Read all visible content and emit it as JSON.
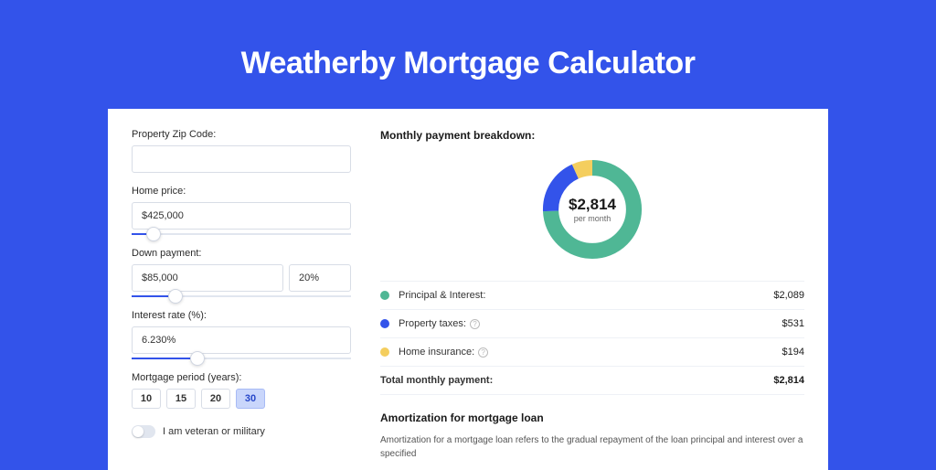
{
  "title": "Weatherby Mortgage Calculator",
  "form": {
    "zip_label": "Property Zip Code:",
    "zip_value": "",
    "home_price_label": "Home price:",
    "home_price_value": "$425,000",
    "home_price_slider_pct": 10,
    "down_payment_label": "Down payment:",
    "down_payment_value": "$85,000",
    "down_payment_pct": "20%",
    "down_payment_slider_pct": 20,
    "interest_label": "Interest rate (%):",
    "interest_value": "6.230%",
    "interest_slider_pct": 30,
    "period_label": "Mortgage period (years):",
    "period_options": [
      "10",
      "15",
      "20",
      "30"
    ],
    "period_selected": "30",
    "veteran_label": "I am veteran or military"
  },
  "breakdown": {
    "title": "Monthly payment breakdown:",
    "donut_amount": "$2,814",
    "donut_sub": "per month",
    "rows": [
      {
        "color": "green",
        "label": "Principal & Interest:",
        "value": "$2,089",
        "info": false
      },
      {
        "color": "blue",
        "label": "Property taxes:",
        "value": "$531",
        "info": true
      },
      {
        "color": "yellow",
        "label": "Home insurance:",
        "value": "$194",
        "info": true
      }
    ],
    "total_label": "Total monthly payment:",
    "total_value": "$2,814"
  },
  "chart_data": {
    "type": "pie",
    "title": "Monthly payment breakdown",
    "series": [
      {
        "name": "Principal & Interest",
        "value": 2089,
        "color": "#4FB795"
      },
      {
        "name": "Property taxes",
        "value": 531,
        "color": "#3353EA"
      },
      {
        "name": "Home insurance",
        "value": 194,
        "color": "#F4CE5E"
      }
    ],
    "total": 2814
  },
  "amort": {
    "title": "Amortization for mortgage loan",
    "text": "Amortization for a mortgage loan refers to the gradual repayment of the loan principal and interest over a specified"
  }
}
